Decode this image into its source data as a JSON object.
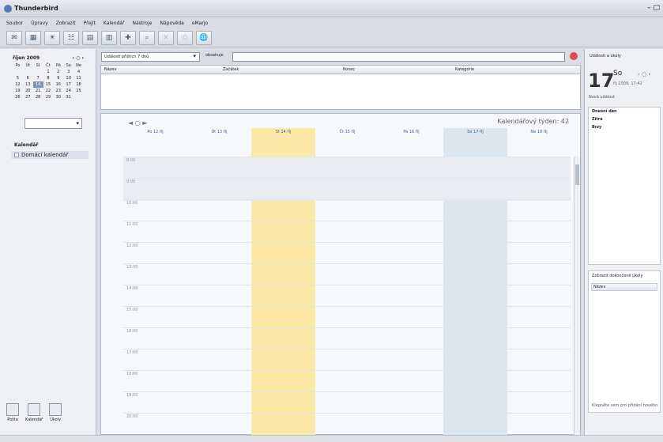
{
  "window": {
    "title": "Thunderbird"
  },
  "menu": [
    "Soubor",
    "Úpravy",
    "Zobrazit",
    "Přejít",
    "Kalendář",
    "Nástroje",
    "Nápověda",
    "eMarjo"
  ],
  "toolbar": {
    "icons": [
      "mail-icon",
      "calendar-icon",
      "today-icon",
      "week-icon",
      "month-icon",
      "multiweek-icon",
      "new-task-icon",
      "search-icon",
      "delete-icon",
      "print-icon",
      "subscribe-icon"
    ]
  },
  "mini_calendar": {
    "header": "říjen 2009",
    "nav": "‹ ○ ›",
    "weekdays": [
      "Po",
      "Út",
      "St",
      "Čt",
      "Pá",
      "So",
      "Ne"
    ],
    "weeks": [
      [
        "",
        "",
        "",
        "1",
        "2",
        "3",
        "4"
      ],
      [
        "5",
        "6",
        "7",
        "8",
        "9",
        "10",
        "11"
      ],
      [
        "12",
        "13",
        "14",
        "15",
        "16",
        "17",
        "18"
      ],
      [
        "19",
        "20",
        "21",
        "22",
        "23",
        "24",
        "25"
      ],
      [
        "26",
        "27",
        "28",
        "29",
        "30",
        "31",
        ""
      ]
    ],
    "today": "14"
  },
  "left": {
    "calendar_header": "Kalendář",
    "calendar_item": "Domácí kalendář"
  },
  "modes": [
    "Pošta",
    "Kalendář",
    "Úkoly"
  ],
  "filter": {
    "events_range": "Události příštích 7 dnů",
    "contains_label": "obsahuje"
  },
  "table": {
    "headers": [
      "Název",
      "Začátek",
      "Konec",
      "Kategorie"
    ]
  },
  "week": {
    "nav": "◄ ○ ►",
    "label": "Kalendářový týden: 42",
    "days": [
      {
        "name": "Po 12 říj"
      },
      {
        "name": "Út 13 říj"
      },
      {
        "name": "St 14 říj"
      },
      {
        "name": "Čt 15 říj"
      },
      {
        "name": "Pá 16 říj"
      },
      {
        "name": "So 17 říj"
      },
      {
        "name": "Ne 18 říj"
      }
    ],
    "times": [
      "8:00",
      "9:00",
      "10:00",
      "11:00",
      "12:00",
      "13:00",
      "14:00",
      "15:00",
      "16:00",
      "17:00",
      "18:00",
      "19:00",
      "20:00"
    ]
  },
  "right": {
    "header": "Události a úkoly",
    "big_day": "17",
    "big_dow": "So",
    "date": "říj 2009, 17:42",
    "nav": "‹ ○ ›",
    "new_event": "Nová událost",
    "groups": [
      "Dnešní den",
      "Zítra",
      "Brzy"
    ],
    "task_toggle": "Zobrazit dokončené úkoly",
    "task_cols": [
      "Název"
    ],
    "task_hint": "Klepněte sem pro přidání nového"
  }
}
